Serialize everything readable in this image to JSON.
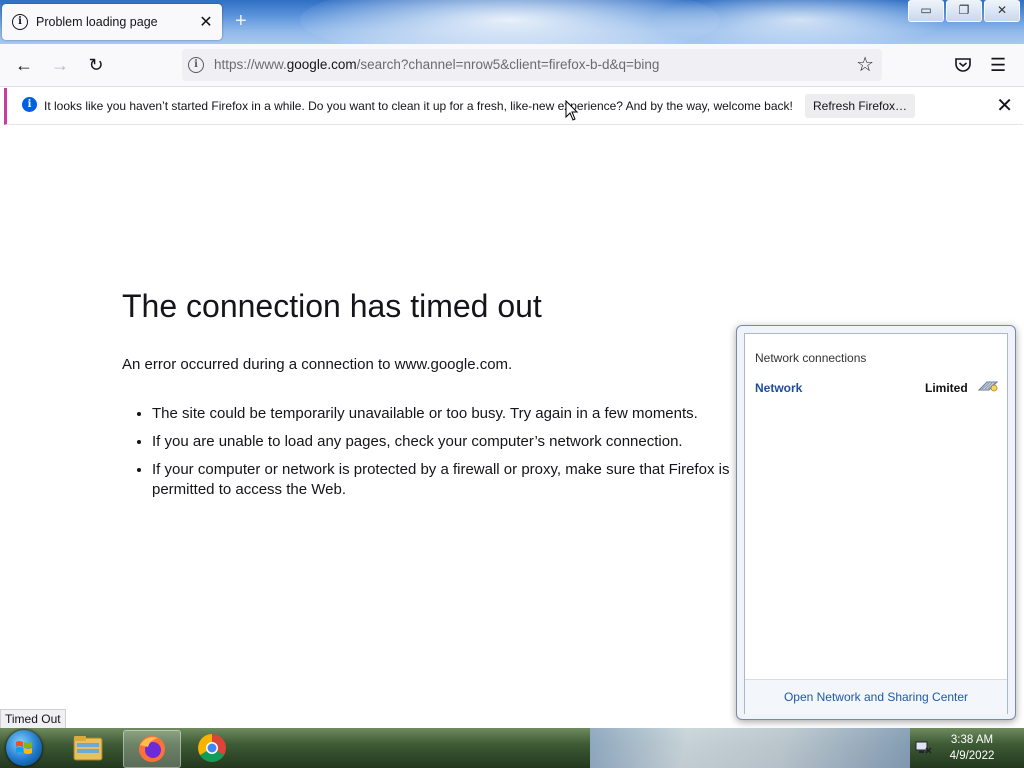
{
  "tab": {
    "title": "Problem loading page",
    "close_glyph": "✕",
    "newtab_glyph": "+"
  },
  "window_controls": {
    "minimize": "▭",
    "restore": "❐",
    "close": "✕"
  },
  "nav": {
    "back_glyph": "←",
    "forward_glyph": "→",
    "reload_glyph": "↻",
    "url_prefix": "https://www.",
    "url_domain": "google.com",
    "url_rest": "/search?channel=nrow5&client=firefox-b-d&q=bing",
    "star_glyph": "☆",
    "pocket_glyph": "◡",
    "menu_glyph": "☰"
  },
  "notification": {
    "text": "It looks like you haven’t started Firefox in a while. Do you want to clean it up for a fresh, like-new experience? And by the way, welcome back!",
    "button_label": "Refresh Firefox…",
    "close_glyph": "✕"
  },
  "error": {
    "title": "The connection has timed out",
    "description": "An error occurred during a connection to www.google.com.",
    "items": [
      "The site could be temporarily unavailable or too busy. Try again in a few moments.",
      "If you are unable to load any pages, check your computer’s network connection.",
      "If your computer or network is protected by a firewall or proxy, make sure that Firefox is permitted to access the Web."
    ]
  },
  "status_text": "Timed Out",
  "network_popup": {
    "heading": "Network connections",
    "network_name": "Network",
    "network_status": "Limited",
    "footer_link": "Open Network and Sharing Center"
  },
  "taskbar": {
    "items": [
      "file-explorer",
      "firefox",
      "chrome"
    ],
    "clock_time": "3:38 AM",
    "clock_date": "4/9/2022"
  },
  "colors": {
    "accent": "#0060df",
    "notification_border": "#c83fa4",
    "link": "#1e5aa8"
  }
}
